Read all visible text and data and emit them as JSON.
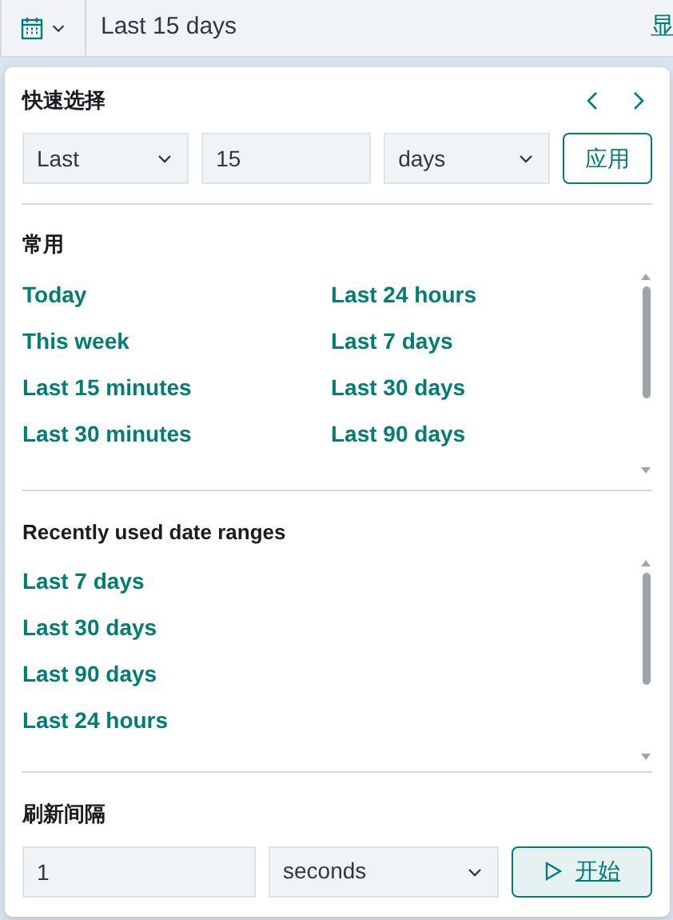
{
  "top_bar": {
    "range_text": "Last 15 days",
    "right_text": "显"
  },
  "quick_select": {
    "title": "快速选择",
    "direction": "Last",
    "amount": "15",
    "unit": "days",
    "apply": "应用"
  },
  "common": {
    "title": "常用",
    "items": [
      {
        "label": "Today"
      },
      {
        "label": "Last 24 hours"
      },
      {
        "label": "This week"
      },
      {
        "label": "Last 7 days"
      },
      {
        "label": "Last 15 minutes"
      },
      {
        "label": "Last 30 days"
      },
      {
        "label": "Last 30 minutes"
      },
      {
        "label": "Last 90 days"
      }
    ]
  },
  "recent": {
    "title": "Recently used date ranges",
    "items": [
      {
        "label": "Last 7 days"
      },
      {
        "label": "Last 30 days"
      },
      {
        "label": "Last 90 days"
      },
      {
        "label": "Last 24 hours"
      }
    ]
  },
  "refresh": {
    "title": "刷新间隔",
    "value": "1",
    "unit": "seconds",
    "start": "开始"
  }
}
